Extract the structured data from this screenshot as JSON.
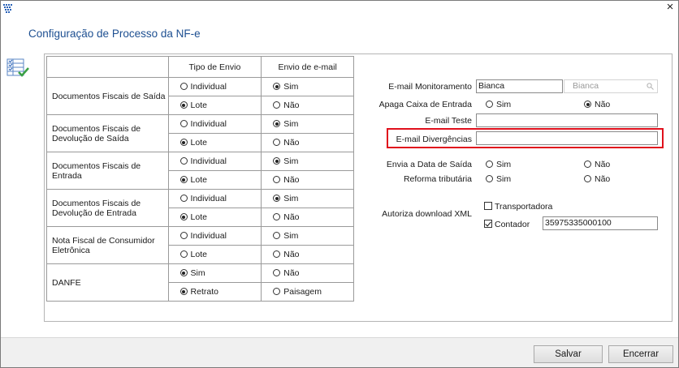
{
  "window": {
    "title": "Configuração de Processo da NF-e",
    "close_glyph": "×"
  },
  "table": {
    "header_tipo": "Tipo de Envio",
    "header_email": "Envio de e-mail",
    "rows": [
      {
        "label": "Documentos Fiscais de Saída",
        "tipo": [
          "Individual",
          "Lote"
        ],
        "tipo_sel": 1,
        "email": [
          "Sim",
          "Não"
        ],
        "email_sel": 0
      },
      {
        "label": "Documentos Fiscais de Devolução de Saída",
        "tipo": [
          "Individual",
          "Lote"
        ],
        "tipo_sel": 1,
        "email": [
          "Sim",
          "Não"
        ],
        "email_sel": 0
      },
      {
        "label": "Documentos Fiscais de Entrada",
        "tipo": [
          "Individual",
          "Lote"
        ],
        "tipo_sel": 1,
        "email": [
          "Sim",
          "Não"
        ],
        "email_sel": 0
      },
      {
        "label": "Documentos Fiscais de Devolução de Entrada",
        "tipo": [
          "Individual",
          "Lote"
        ],
        "tipo_sel": 1,
        "email": [
          "Sim",
          "Não"
        ],
        "email_sel": 0
      },
      {
        "label": "Nota Fiscal de Consumidor Eletrônica",
        "tipo": [
          "Individual",
          "Lote"
        ],
        "tipo_sel": -1,
        "email": [
          "Sim",
          "Não"
        ],
        "email_sel": -1
      },
      {
        "label": "DANFE",
        "tipo": [
          "Sim",
          "Retrato"
        ],
        "tipo_sel": "both",
        "email": [
          "Não",
          "Paisagem"
        ],
        "email_sel": -1
      }
    ]
  },
  "right": {
    "email_monitoramento_label": "E-mail Monitoramento",
    "email_monitoramento_value": "Bianca",
    "email_monitoramento_search": "Bianca",
    "apaga_label": "Apaga Caixa de Entrada",
    "apaga_sim": "Sim",
    "apaga_nao": "Não",
    "email_teste_label": "E-mail Teste",
    "email_teste_value": "",
    "email_div_label": "E-mail Divergências",
    "email_div_value": "",
    "envia_label": "Envia a Data de Saída",
    "envia_sim": "Sim",
    "envia_nao": "Não",
    "reforma_label": "Reforma tributária",
    "reforma_sim": "Sim",
    "reforma_nao": "Não",
    "autoriza_label": "Autoriza download XML",
    "transportadora": "Transportadora",
    "contador": "Contador",
    "contador_value": "35975335000100"
  },
  "buttons": {
    "salvar": "Salvar",
    "encerrar": "Encerrar"
  },
  "colors": {
    "title": "#1d4f91",
    "highlight": "#e0101c"
  }
}
